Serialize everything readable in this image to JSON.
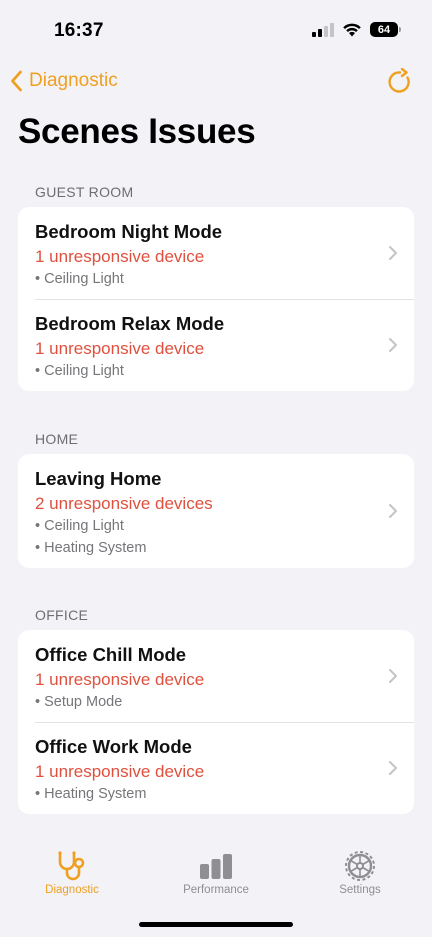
{
  "status_bar": {
    "time": "16:37",
    "battery": "64"
  },
  "nav": {
    "back_label": "Diagnostic",
    "title": "Scenes Issues"
  },
  "sections": [
    {
      "header": "GUEST ROOM",
      "rows": [
        {
          "title": "Bedroom Night Mode",
          "issue": "1 unresponsive device",
          "devices": [
            "• Ceiling Light"
          ]
        },
        {
          "title": "Bedroom Relax Mode",
          "issue": "1 unresponsive device",
          "devices": [
            "• Ceiling Light"
          ]
        }
      ]
    },
    {
      "header": "HOME",
      "rows": [
        {
          "title": "Leaving Home",
          "issue": "2 unresponsive devices",
          "devices": [
            "• Ceiling Light",
            "• Heating System"
          ]
        }
      ]
    },
    {
      "header": "OFFICE",
      "rows": [
        {
          "title": "Office Chill Mode",
          "issue": "1 unresponsive device",
          "devices": [
            "• Setup Mode"
          ]
        },
        {
          "title": "Office Work Mode",
          "issue": "1 unresponsive device",
          "devices": [
            "• Heating System"
          ]
        }
      ]
    }
  ],
  "tabs": [
    {
      "label": "Diagnostic",
      "icon": "stethoscope-icon",
      "active": true
    },
    {
      "label": "Performance",
      "icon": "bar-chart-icon",
      "active": false
    },
    {
      "label": "Settings",
      "icon": "gear-icon",
      "active": false
    }
  ],
  "colors": {
    "accent": "#f0a020",
    "issue": "#e0503e",
    "inactive_tab": "#8e8e93",
    "background": "#f2f2f7"
  }
}
